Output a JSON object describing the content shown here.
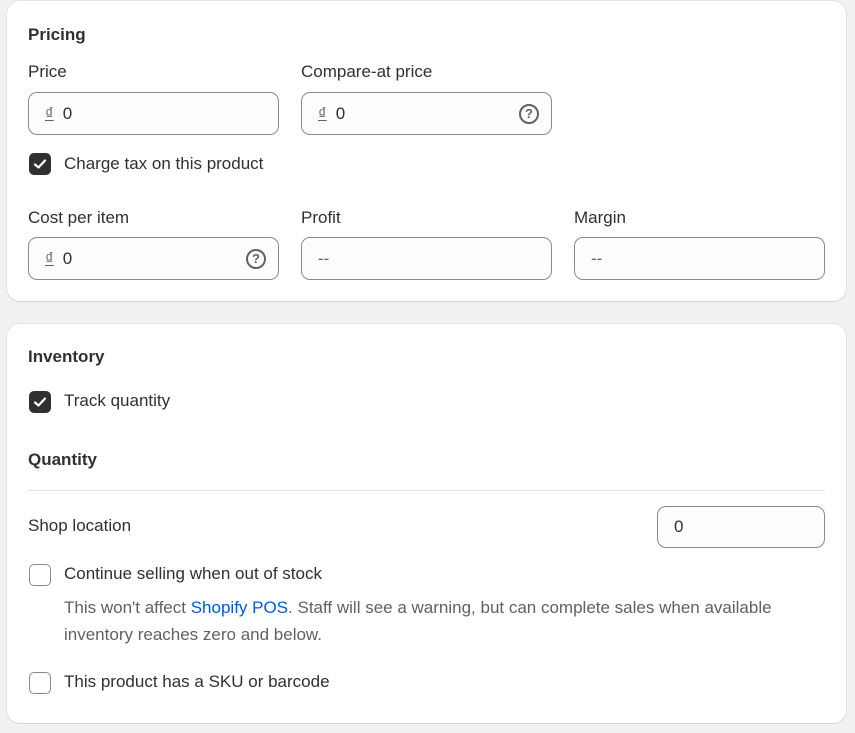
{
  "pricing": {
    "title": "Pricing",
    "price": {
      "label": "Price",
      "currency_symbol": "₫",
      "value": "0"
    },
    "compare_at_price": {
      "label": "Compare-at price",
      "currency_symbol": "₫",
      "value": "0",
      "help_icon": "question-circle-icon"
    },
    "charge_tax": {
      "label": "Charge tax on this product",
      "checked": true
    },
    "cost_per_item": {
      "label": "Cost per item",
      "currency_symbol": "₫",
      "value": "0",
      "help_icon": "question-circle-icon"
    },
    "profit": {
      "label": "Profit",
      "value": "--"
    },
    "margin": {
      "label": "Margin",
      "value": "--"
    }
  },
  "inventory": {
    "title": "Inventory",
    "track_quantity": {
      "label": "Track quantity",
      "checked": true
    },
    "quantity_title": "Quantity",
    "shop_location": {
      "label": "Shop location",
      "value": "0"
    },
    "continue_selling": {
      "label": "Continue selling when out of stock",
      "checked": false,
      "help_prefix": "This won't affect ",
      "help_link": "Shopify POS",
      "help_suffix": ". Staff will see a warning, but can complete sales when available inventory reaches zero and below."
    },
    "sku_barcode": {
      "label": "This product has a SKU or barcode",
      "checked": false
    }
  },
  "colors": {
    "background": "#f1f1f1",
    "card": "#ffffff",
    "text": "#303030",
    "muted_text": "#616161",
    "link": "#005bd3",
    "checkbox_checked": "#303030",
    "field_border": "#8a8a8a"
  }
}
